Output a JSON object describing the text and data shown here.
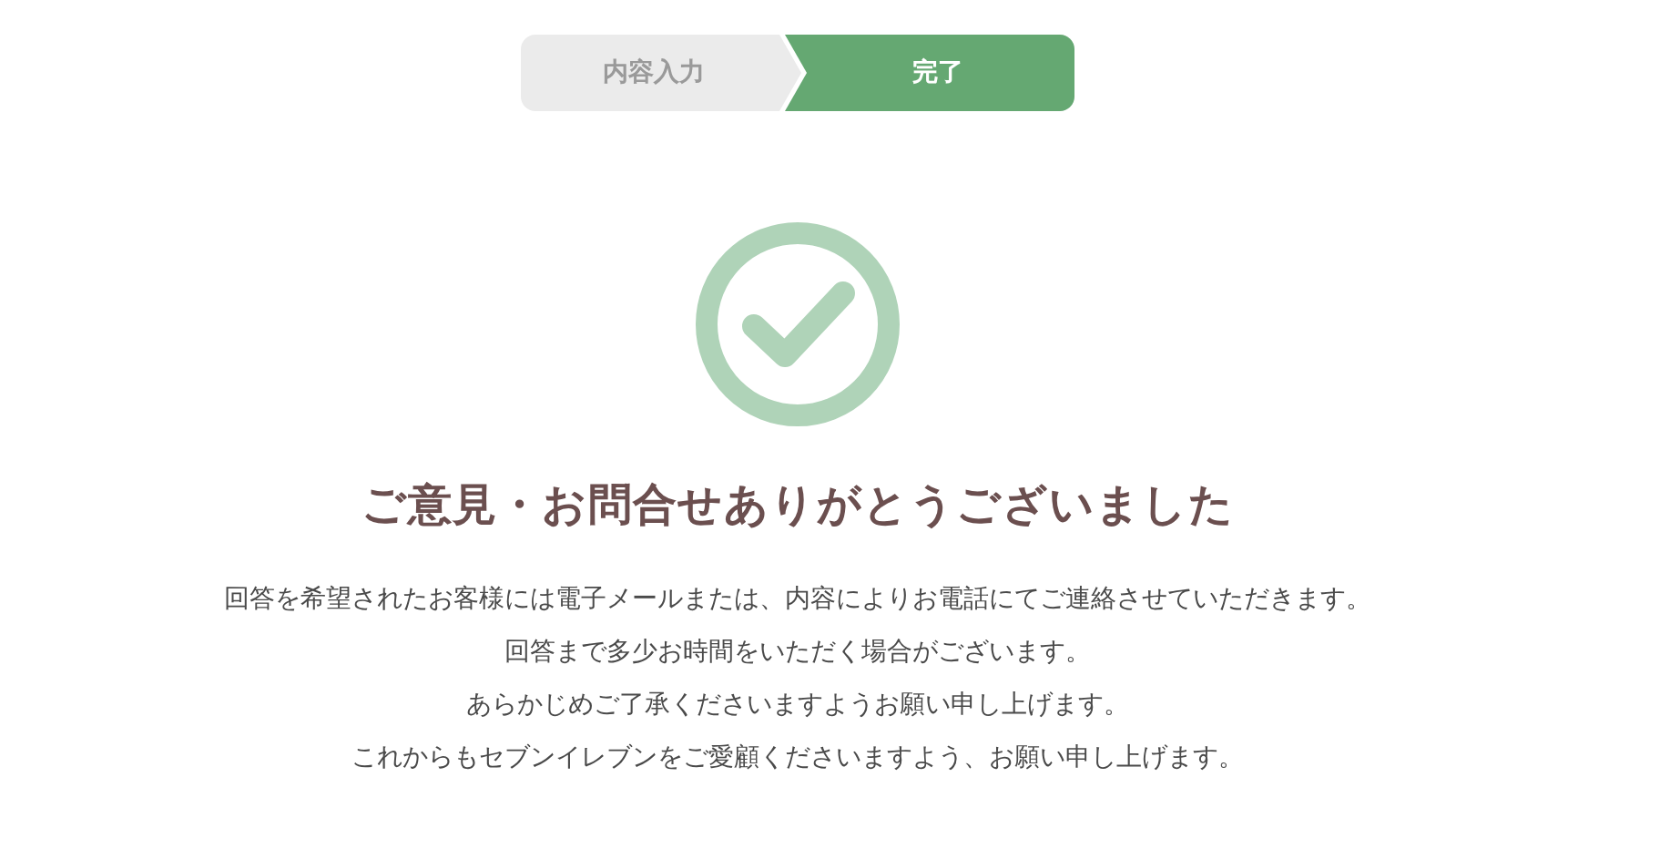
{
  "steps": [
    {
      "label": "内容入力",
      "selected": false
    },
    {
      "label": "完了",
      "selected": true
    }
  ],
  "title": "ご意見・お問合せありがとうございました",
  "message_lines": [
    "回答を希望されたお客様には電子メールまたは、内容によりお電話にてご連絡させていただきます。",
    "回答まで多少お時間をいただく場合がございます。",
    "あらかじめご了承くださいますようお願い申し上げます。",
    "これからもセブンイレブンをご愛顧くださいますよう、お願い申し上げます。"
  ]
}
